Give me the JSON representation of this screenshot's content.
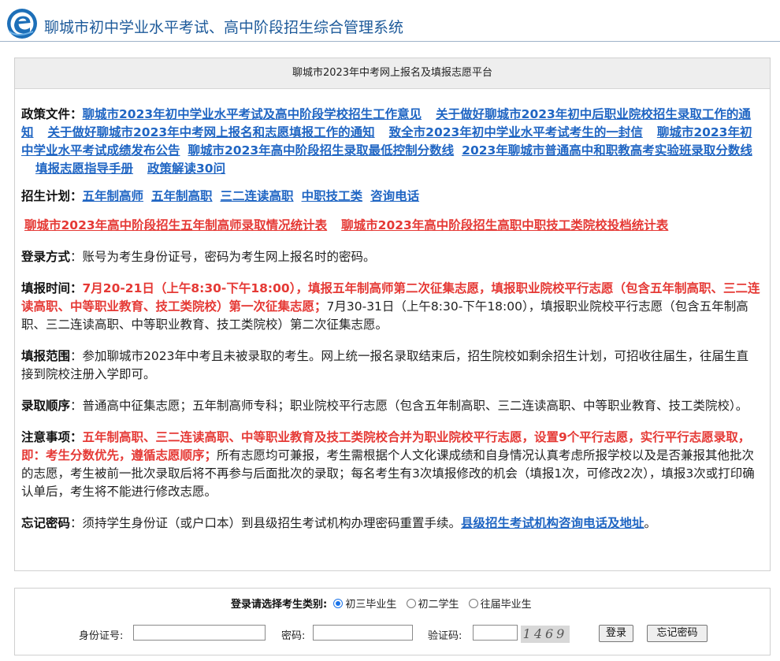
{
  "header": {
    "logo_icon": "circular-e-logo-icon",
    "title": "聊城市初中学业水平考试、高中阶段招生综合管理系统"
  },
  "colors": {
    "title": "#1d5a9a",
    "link": "#1f65c3",
    "highlight": "#e53935",
    "panel_header_bg": "#eeeeee"
  },
  "panel": {
    "title": "聊城市2023年中考网上报名及填报志愿平台",
    "policy": {
      "label": "政策文件：",
      "links": [
        "聊城市2023年初中学业水平考试及高中阶段学校招生工作意见",
        "关于做好聊城市2023年初中后职业院校招生录取工作的通知",
        "关于做好聊城市2023年中考网上报名和志愿填报工作的通知",
        "致全市2023年初中学业水平考试考生的一封信",
        "聊城市2023年初中学业水平考试成绩发布公告",
        "聊城市2023年高中阶段招生录取最低控制分数线",
        "2023年聊城市普通高中和职教高考实验班录取分数线",
        "填报志愿指导手册",
        "政策解读30问"
      ]
    },
    "plan": {
      "label": "招生计划：",
      "links": [
        "五年制高师",
        "五年制高职",
        "三二连读高职",
        "中职技工类",
        "咨询电话"
      ]
    },
    "stats_links": [
      "聊城市2023年高中阶段招生五年制高师录取情况统计表",
      "聊城市2023年高中阶段招生高职中职技工类院校投档统计表"
    ],
    "login_method": {
      "label": "登录方式",
      "text": "：账号为考生身份证号，密码为考生网上报名时的密码。"
    },
    "fill_time": {
      "label": "填报时间：",
      "red_text": "7月20-21日（上午8:30-下午18:00），填报五年制高师第二次征集志愿，填报职业院校平行志愿（包含五年制高职、三二连读高职、中等职业教育、技工类院校）第一次征集志愿；",
      "text": "7月30-31日（上午8:30-下午18:00），填报职业院校平行志愿（包含五年制高职、三二连读高职、中等职业教育、技工类院校）第二次征集志愿。"
    },
    "fill_scope": {
      "label": "填报范围",
      "text": "：参加聊城市2023年中考且未被录取的考生。网上统一报名录取结束后，招生院校如剩余招生计划，可招收往届生，往届生直接到院校注册入学即可。"
    },
    "admission_order": {
      "label": "录取顺序",
      "text": "：普通高中征集志愿；五年制高师专科；职业院校平行志愿（包含五年制高职、三二连读高职、中等职业教育、技工类院校）。"
    },
    "notes": {
      "label": "注意事项：",
      "red_text": "五年制高职、三二连读高职、中等职业教育及技工类院校合并为职业院校平行志愿，设置9个平行志愿，实行平行志愿录取，即：考生分数优先，遵循志愿顺序；",
      "text": "所有志愿均可兼报，考生需根据个人文化课成绩和自身情况认真考虑所报学校以及是否兼报其他批次的志愿，考生被前一批次录取后将不再参与后面批次的录取；每名考生有3次填报修改的机会（填报1次，可修改2次），填报3次或打印确认单后，考生将不能进行修改志愿。"
    },
    "forgot": {
      "label": "忘记密码",
      "text": "：须持学生身份证（或户口本）到县级招生考试机构办理密码重置手续。",
      "link": "县级招生考试机构咨询电话及地址",
      "tail": "。"
    }
  },
  "login": {
    "type_label": "登录请选择考生类别:",
    "options": [
      "初三毕业生",
      "初二学生",
      "往届毕业生"
    ],
    "selected": "初三毕业生",
    "id_label": "身份证号:",
    "id_value": "",
    "password_label": "密码:",
    "password_value": "",
    "captcha_label": "验证码:",
    "captcha_value": "",
    "captcha_image_text": "1469",
    "login_button": "登录",
    "forgot_button": "忘记密码"
  }
}
